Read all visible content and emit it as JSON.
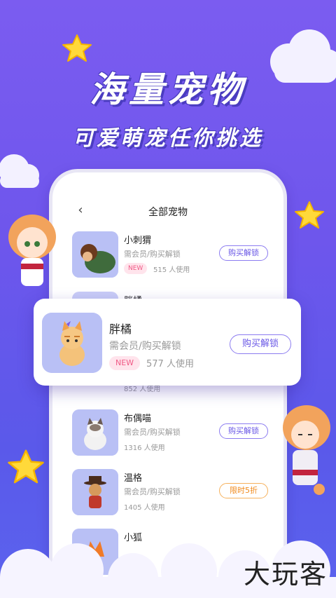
{
  "banner": {
    "headline": "海量宠物",
    "subline": "可爱萌宠任你挑选"
  },
  "screen": {
    "back_icon": "chevron-left-icon",
    "title": "全部宠物"
  },
  "pets": [
    {
      "name": "小刺猬",
      "requirement": "需会员/购买解锁",
      "badge": "NEW",
      "users": "515 人使用",
      "button": "购买解锁"
    },
    {
      "name": "胖橘",
      "requirement": "",
      "badge": "",
      "users": "852 人使用",
      "button": ""
    },
    {
      "name": "布偶喵",
      "requirement": "需会员/购买解锁",
      "badge": "",
      "users": "1316 人使用",
      "button": "购买解锁"
    },
    {
      "name": "温格",
      "requirement": "需会员/购买解锁",
      "badge": "",
      "users": "1405 人使用",
      "button": "限时5折"
    },
    {
      "name": "小狐",
      "requirement": "",
      "badge": "",
      "users": "",
      "button": ""
    }
  ],
  "popup": {
    "name": "胖橘",
    "requirement": "需会员/购买解锁",
    "badge": "NEW",
    "users": "577 人使用",
    "button": "购买解锁"
  },
  "watermark": "大玩客",
  "colors": {
    "background": "#6e56ec",
    "accent": "#6a58e6",
    "badge": "#f05a86",
    "sale": "#f08a1c"
  }
}
